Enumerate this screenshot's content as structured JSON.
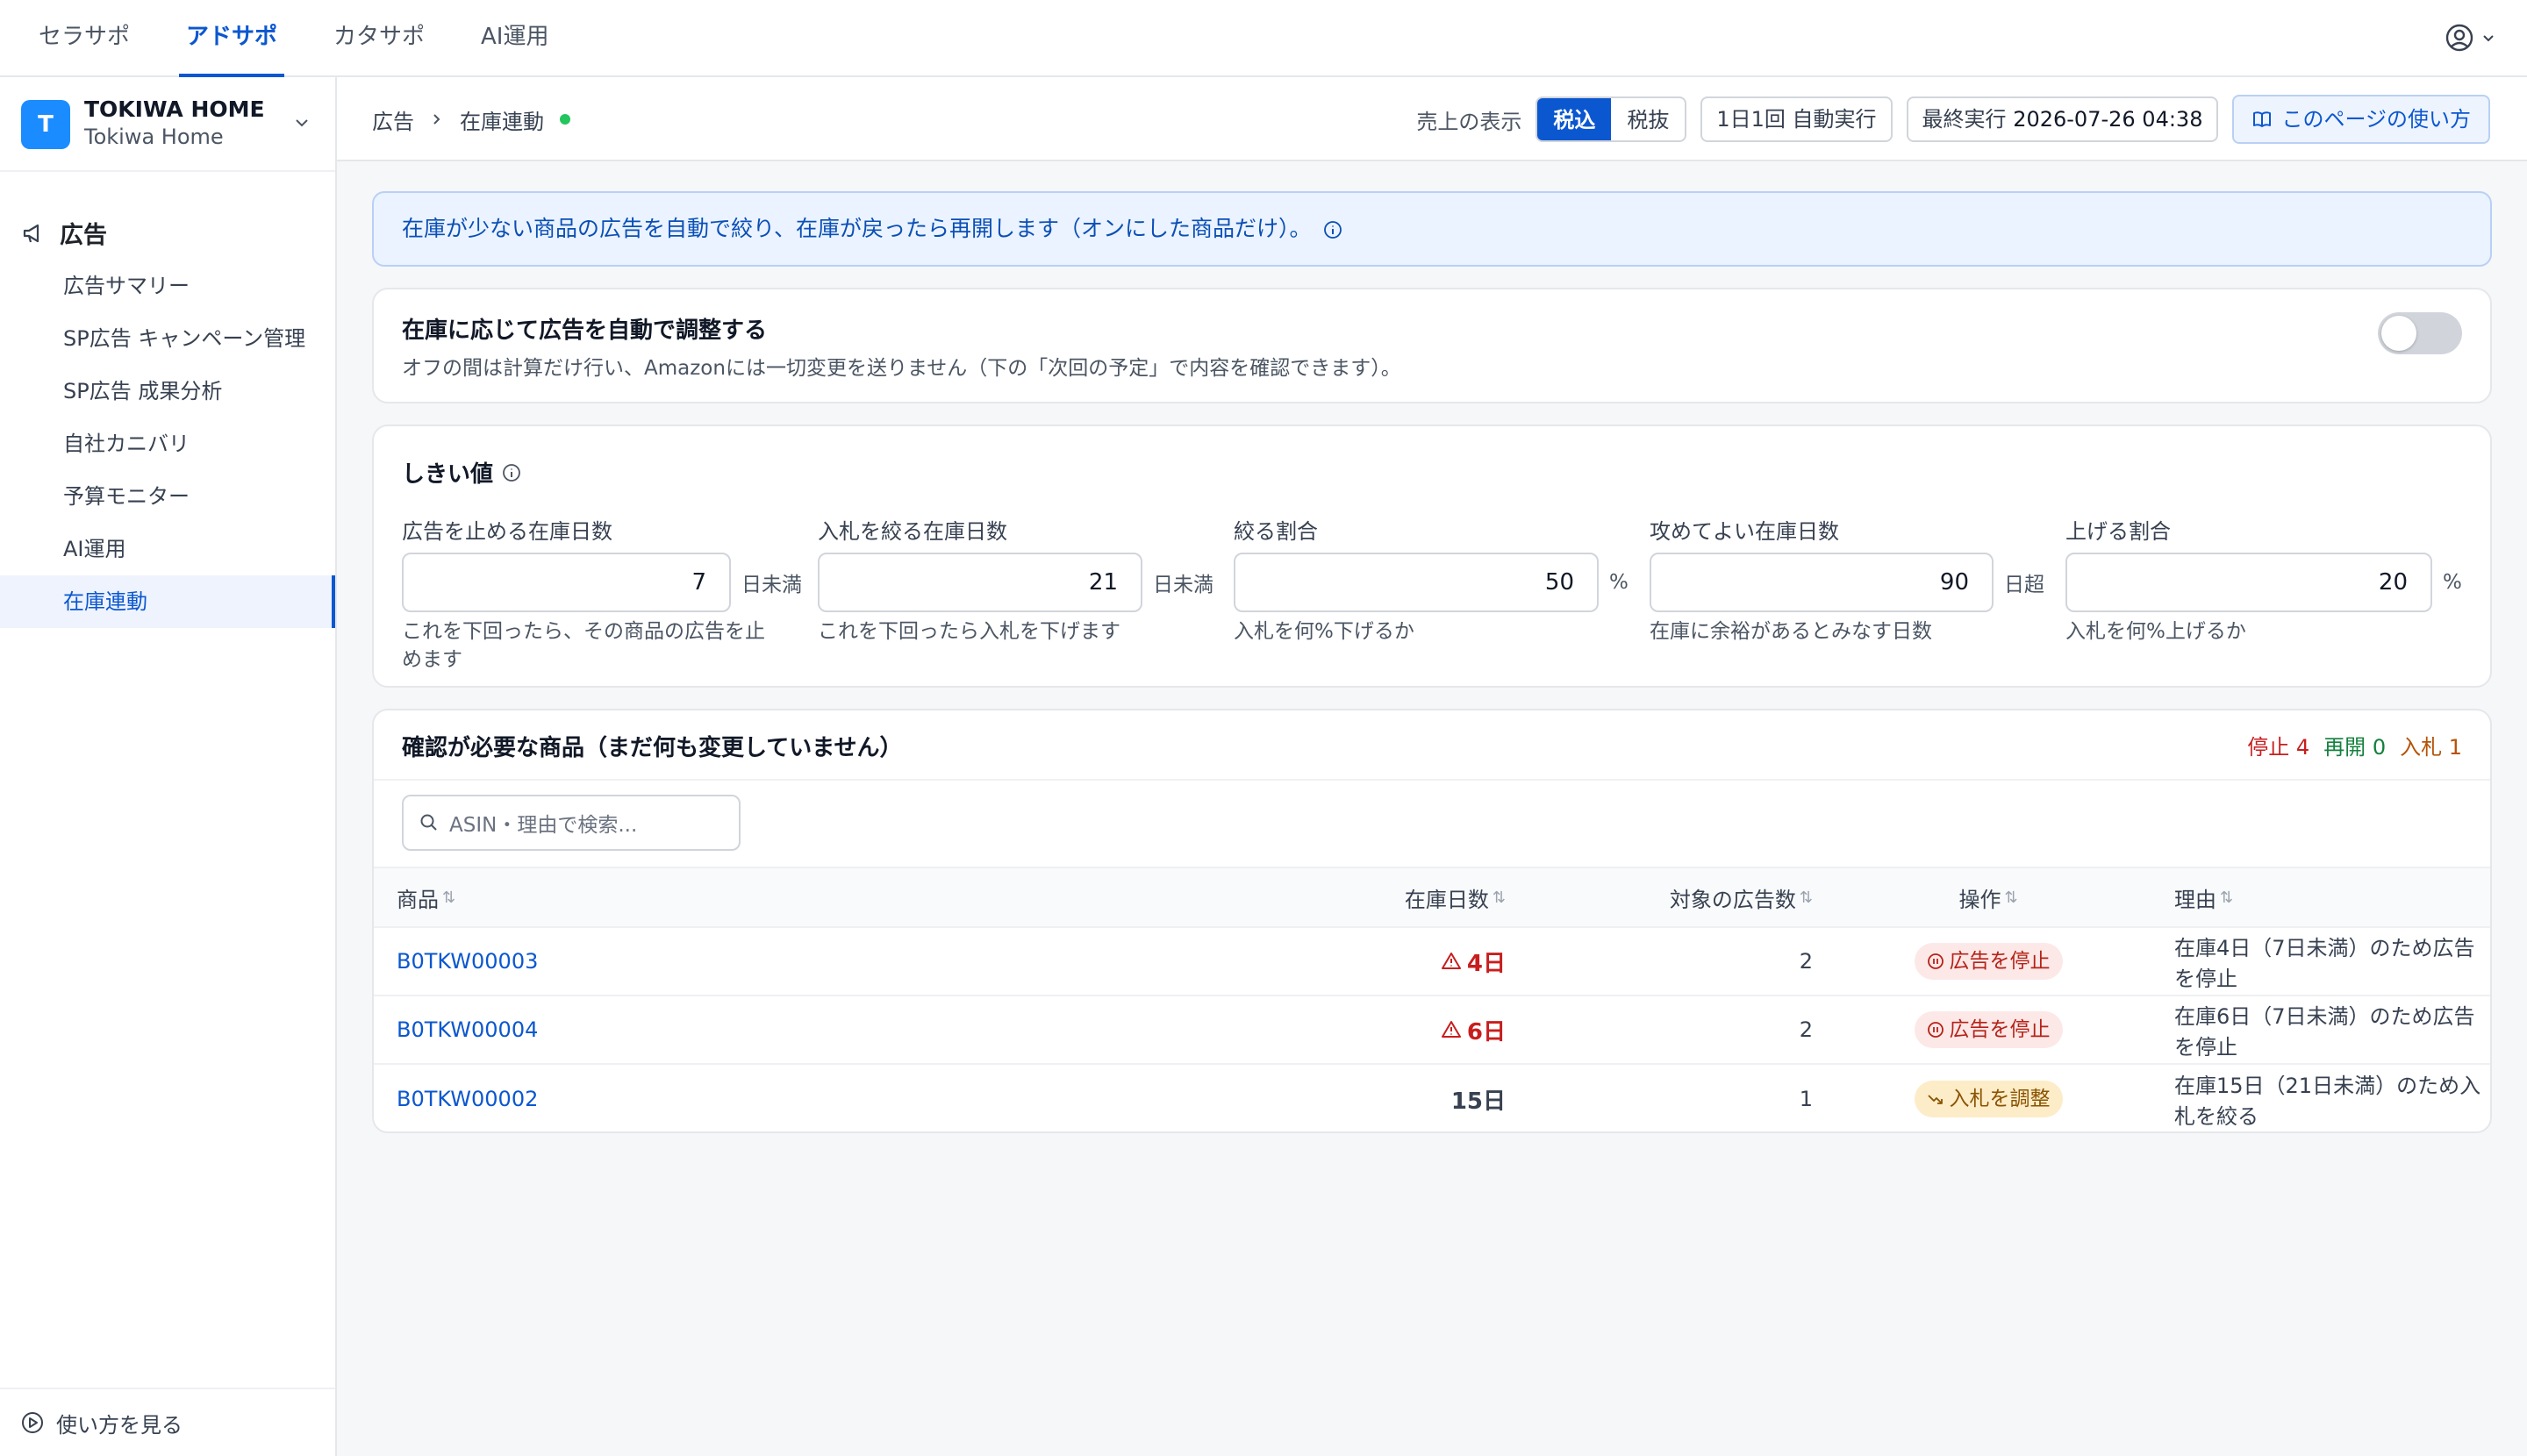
{
  "topnav": {
    "tabs": [
      "セラサポ",
      "アドサポ",
      "カタサポ",
      "AI運用"
    ],
    "active_tab": "アドサポ"
  },
  "sidebar": {
    "store_initial": "T",
    "store_name": "TOKIWA HOME",
    "store_sub": "Tokiwa Home",
    "section": "広告",
    "items": [
      {
        "label": "広告サマリー"
      },
      {
        "label": "SP広告 キャンペーン管理"
      },
      {
        "label": "SP広告 成果分析"
      },
      {
        "label": "自社カニバリ"
      },
      {
        "label": "予算モニター"
      },
      {
        "label": "AI運用"
      },
      {
        "label": "在庫連動"
      }
    ],
    "active_item": "在庫連動",
    "footer": "使い方を見る"
  },
  "header": {
    "crumb_parent": "広告",
    "crumb_current": "在庫連動",
    "sales_label": "売上の表示",
    "tax_in": "税込",
    "tax_out": "税抜",
    "schedule": "1日1回 自動実行",
    "last_run_label": "最終実行",
    "last_run_value": "2026-07-26 04:38",
    "help": "このページの使い方"
  },
  "banner": {
    "text": "在庫が少ない商品の広告を自動で絞り、在庫が戻ったら再開します（オンにした商品だけ）。"
  },
  "auto_card": {
    "title": "在庫に応じて広告を自動で調整する",
    "desc": "オフの間は計算だけ行い、Amazonには一切変更を送りません（下の「次回の予定」で内容を確認できます）。",
    "enabled": false
  },
  "thresholds": {
    "title": "しきい値",
    "fields": [
      {
        "label": "広告を止める在庫日数",
        "value": "7",
        "unit": "日未満",
        "help1": "これを下回ったら、その商品の広告を止",
        "help2": "めます"
      },
      {
        "label": "入札を絞る在庫日数",
        "value": "21",
        "unit": "日未満",
        "help1": "これを下回ったら入札を下げます",
        "help2": ""
      },
      {
        "label": "絞る割合",
        "value": "50",
        "unit": "%",
        "help1": "入札を何%下げるか",
        "help2": ""
      },
      {
        "label": "攻めてよい在庫日数",
        "value": "90",
        "unit": "日超",
        "help1": "在庫に余裕があるとみなす日数",
        "help2": ""
      },
      {
        "label": "上げる割合",
        "value": "20",
        "unit": "%",
        "help1": "入札を何%上げるか",
        "help2": ""
      }
    ]
  },
  "review": {
    "title": "確認が必要な商品（まだ何も変更していません）",
    "count_stop": "停止 4",
    "count_resume": "再開 0",
    "count_bid": "入札 1",
    "search_placeholder": "ASIN・理由で検索...",
    "columns": {
      "product": "商品",
      "days": "在庫日数",
      "ads": "対象の広告数",
      "action": "操作",
      "reason": "理由"
    },
    "rows": [
      {
        "asin": "B0TKW00003",
        "days": "4日",
        "warn": true,
        "ads": "2",
        "action": "広告を停止",
        "action_type": "stop",
        "reason": "在庫4日（7日未満）のため広告を停止"
      },
      {
        "asin": "B0TKW00004",
        "days": "6日",
        "warn": true,
        "ads": "2",
        "action": "広告を停止",
        "action_type": "stop",
        "reason": "在庫6日（7日未満）のため広告を停止"
      },
      {
        "asin": "B0TKW00002",
        "days": "15日",
        "warn": false,
        "ads": "1",
        "action": "入札を調整",
        "action_type": "adjust",
        "reason": "在庫15日（21日未満）のため入札を絞る"
      }
    ]
  },
  "colors": {
    "accent": "#0b57d0",
    "stop": "#c81e1e",
    "resume": "#15803d",
    "bid": "#b45309"
  }
}
